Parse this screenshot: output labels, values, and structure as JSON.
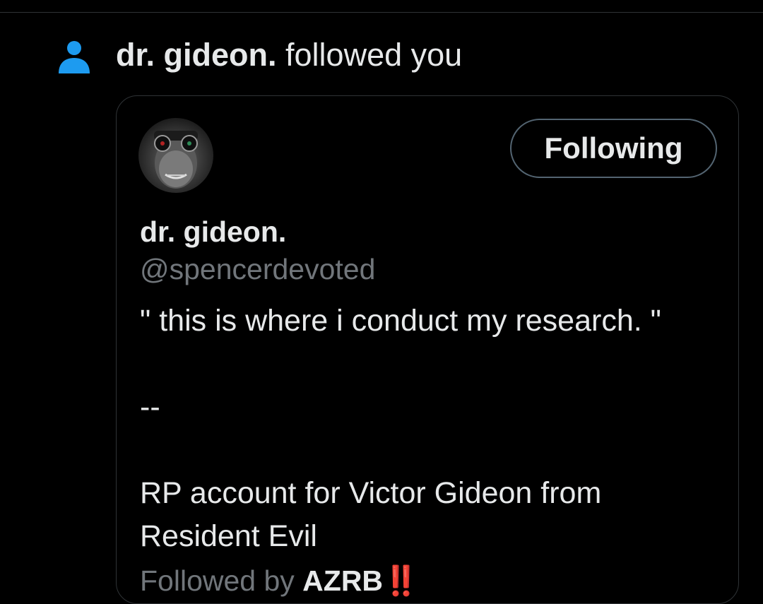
{
  "colors": {
    "background": "#000000",
    "text_primary": "#e7e9ea",
    "text_secondary": "#71767b",
    "accent": "#1d9bf0",
    "border": "#2f3336"
  },
  "notification": {
    "icon": "person-icon",
    "actor_name": "dr. gideon.",
    "action_text": " followed you"
  },
  "user_card": {
    "display_name": "dr. gideon.",
    "handle": "@spencerdevoted",
    "follow_button_label": "Following",
    "bio": "\" this is where i conduct my research. \"\n\n--\n\nRP account for Victor Gideon from Resident Evil",
    "followed_by_prefix": "Followed by ",
    "followed_by_name": "AZRB",
    "followed_by_emoji": "‼️"
  }
}
